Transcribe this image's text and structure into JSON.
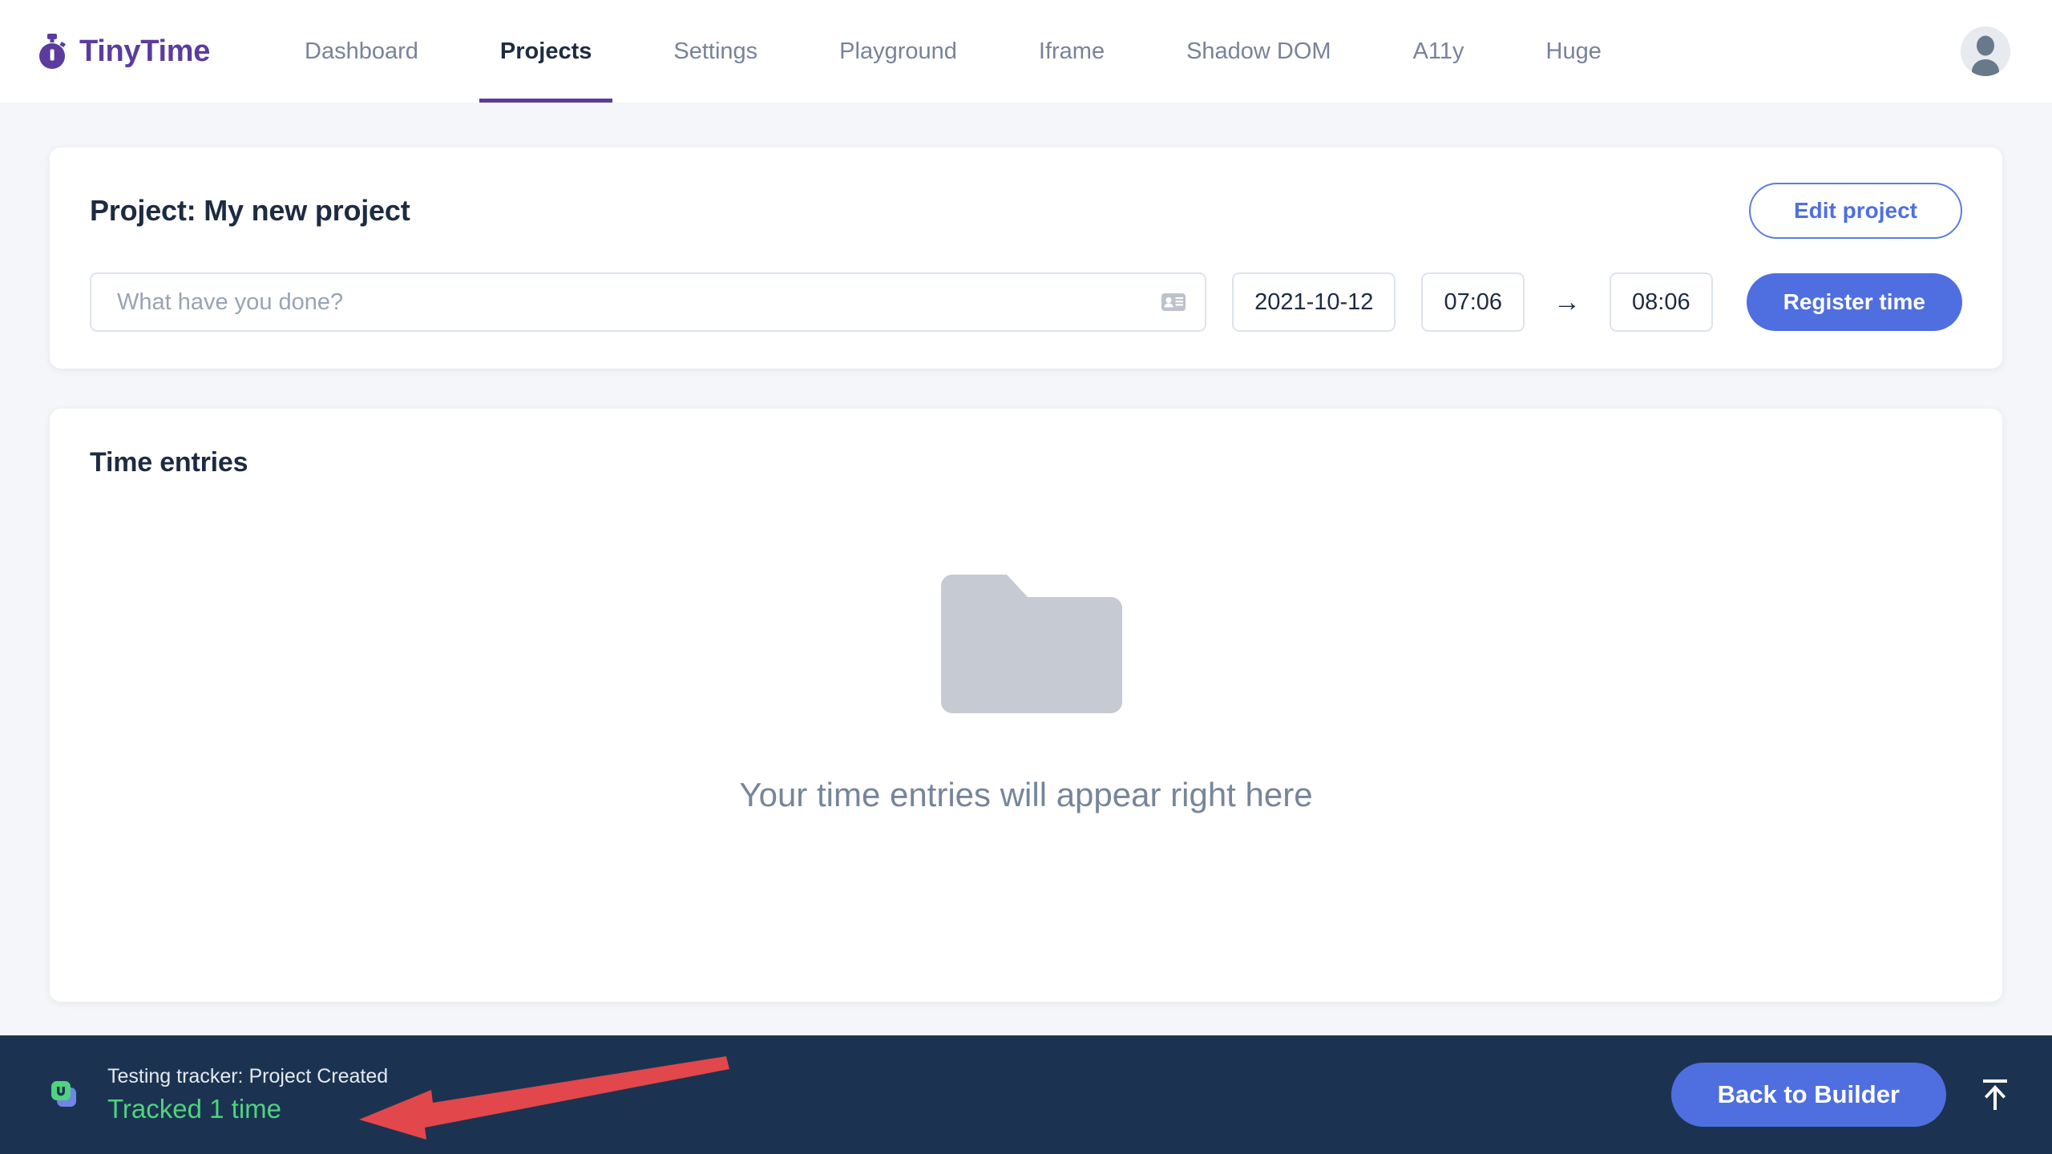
{
  "header": {
    "brand_name": "TinyTime",
    "brand_icon": "stopwatch-icon",
    "nav_items": [
      {
        "label": "Dashboard",
        "active": false
      },
      {
        "label": "Projects",
        "active": true
      },
      {
        "label": "Settings",
        "active": false
      },
      {
        "label": "Playground",
        "active": false
      },
      {
        "label": "Iframe",
        "active": false
      },
      {
        "label": "Shadow DOM",
        "active": false
      },
      {
        "label": "A11y",
        "active": false
      },
      {
        "label": "Huge",
        "active": false
      }
    ],
    "avatar_icon": "user-avatar-icon"
  },
  "project": {
    "title": "Project: My new project",
    "edit_label": "Edit project",
    "task_placeholder": "What have you done?",
    "task_value": "",
    "task_icon": "contact-card-icon",
    "date": "2021-10-12",
    "time_start": "07:06",
    "time_separator": "→",
    "time_end": "08:06",
    "register_label": "Register time"
  },
  "entries": {
    "title": "Time entries",
    "empty_icon": "folder-icon",
    "empty_text": "Your time entries will appear right here"
  },
  "bottombar": {
    "tracker_icon": "usetrace-logo-icon",
    "tracker_title": "Testing tracker: Project Created",
    "tracker_status": "Tracked 1 time",
    "builder_label": "Back to Builder",
    "collapse_icon": "arrow-up-to-line-icon"
  },
  "annotation": {
    "arrow_icon": "red-pointer-arrow",
    "arrow_color": "#e2474b"
  },
  "colors": {
    "brand_purple": "#5b3c9e",
    "primary_blue": "#4f6fe0",
    "dark_navy": "#1b3350",
    "text_dark": "#1d2b42",
    "text_muted": "#77839a",
    "page_bg": "#f4f6f9",
    "status_green": "#4fd37f",
    "annotation_red": "#e2474b"
  }
}
